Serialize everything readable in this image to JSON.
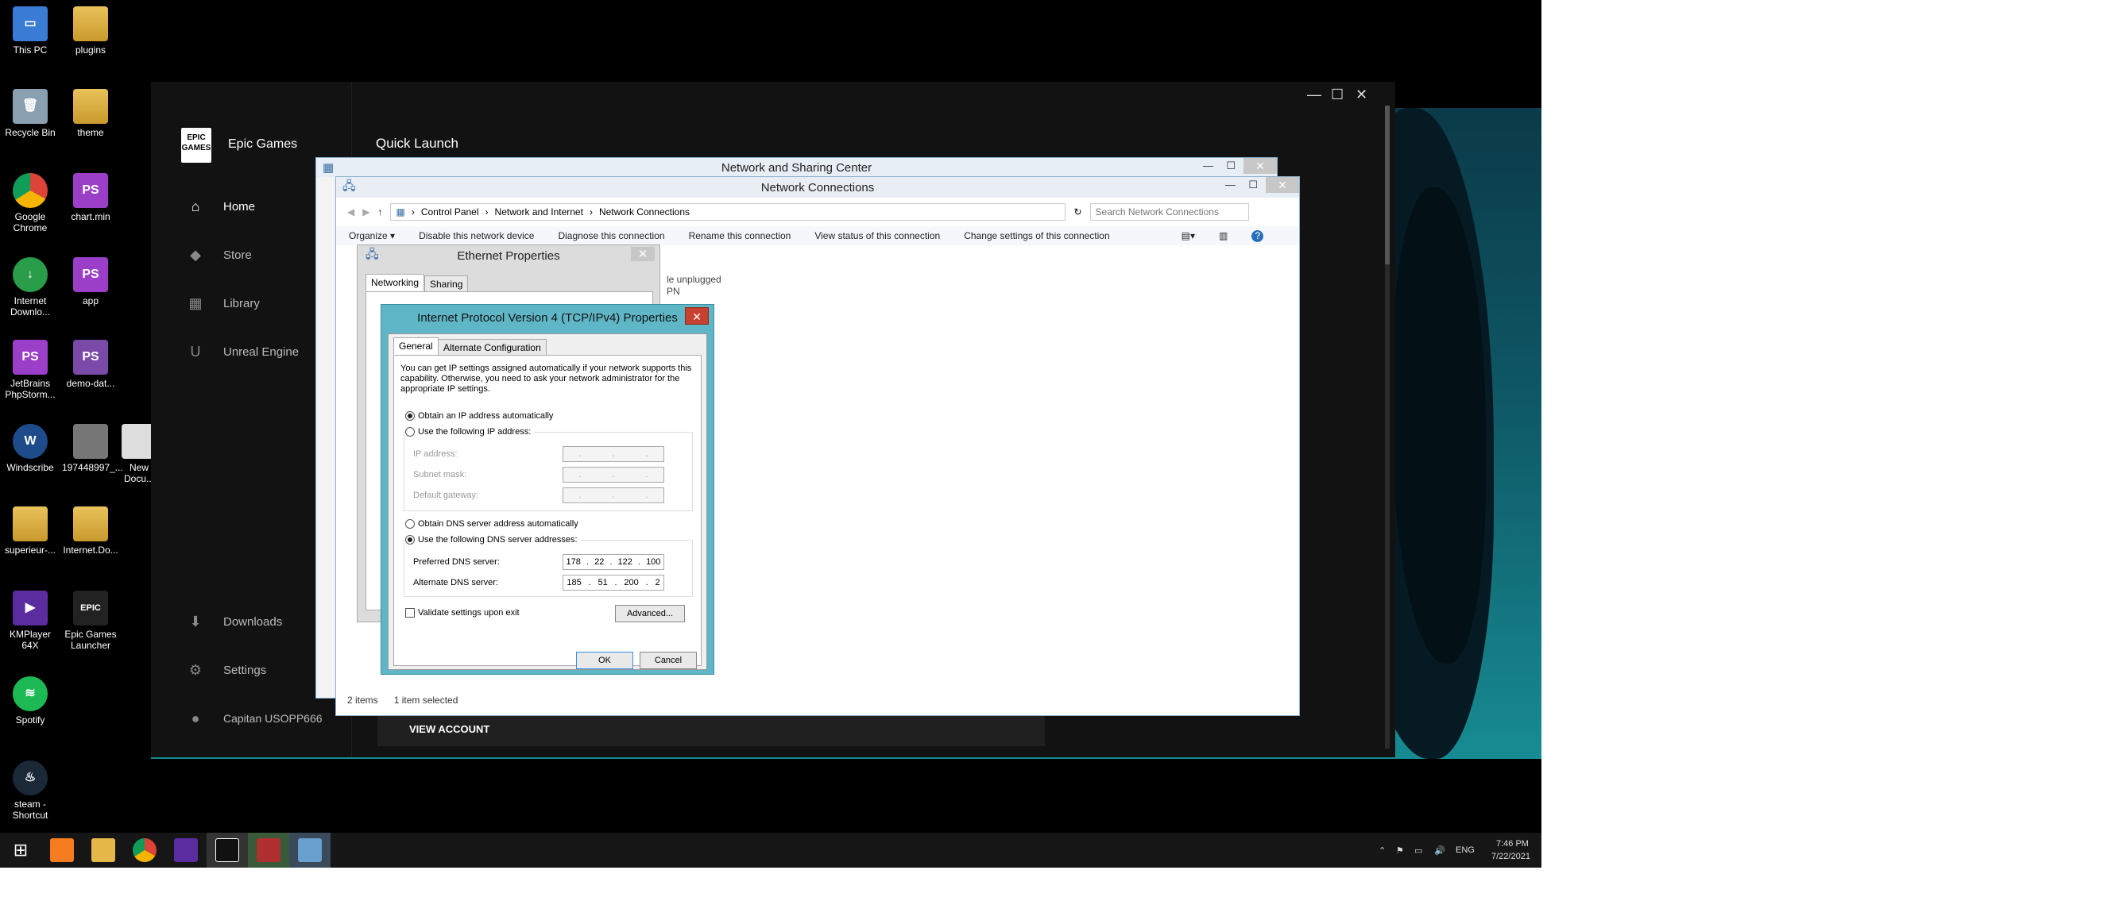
{
  "desktop": {
    "icons": [
      {
        "label": "This PC",
        "icon": "computer-icon"
      },
      {
        "label": "plugins",
        "icon": "folder-icon"
      },
      {
        "label": "Recycle Bin",
        "icon": "recycle-bin-icon"
      },
      {
        "label": "theme",
        "icon": "folder-icon"
      },
      {
        "label": "Google Chrome",
        "icon": "chrome-icon"
      },
      {
        "label": "chart.min",
        "icon": "phpstorm-icon"
      },
      {
        "label": "Internet Downlo...",
        "icon": "idm-icon"
      },
      {
        "label": "app",
        "icon": "phpstorm-icon"
      },
      {
        "label": "JetBrains PhpStorm...",
        "icon": "phpstorm-icon"
      },
      {
        "label": "demo-dat...",
        "icon": "file-icon"
      },
      {
        "label": "Windscribe",
        "icon": "windscribe-icon"
      },
      {
        "label": "197448997_...",
        "icon": "image-icon"
      },
      {
        "label": "New Docu...",
        "icon": "file-icon"
      },
      {
        "label": "superieur-...",
        "icon": "folder-icon"
      },
      {
        "label": "Internet.Do...",
        "icon": "folder-icon"
      },
      {
        "label": "KMPlayer 64X",
        "icon": "kmplayer-icon"
      },
      {
        "label": "Epic Games Launcher",
        "icon": "epic-icon"
      },
      {
        "label": "Spotify",
        "icon": "spotify-icon"
      },
      {
        "label": "steam - Shortcut",
        "icon": "steam-icon"
      }
    ]
  },
  "epic": {
    "brand": "Epic Games",
    "logo": "EPIC GAMES",
    "header": "Quick Launch",
    "nav": [
      {
        "label": "Home",
        "icon": "home-icon"
      },
      {
        "label": "Store",
        "icon": "tag-icon"
      },
      {
        "label": "Library",
        "icon": "grid-icon"
      },
      {
        "label": "Unreal Engine",
        "icon": "unreal-icon"
      }
    ],
    "downloads": "Downloads",
    "settings": "Settings",
    "account": "Capitan USOPP666",
    "view_account": "VIEW ACCOUNT",
    "win_controls": {
      "minimize": "—",
      "maximize": "☐",
      "close": "✕"
    }
  },
  "nsc": {
    "title": "Network and Sharing Center"
  },
  "netconn": {
    "title": "Network Connections",
    "breadcrumb": [
      "Control Panel",
      "Network and Internet",
      "Network Connections"
    ],
    "search_placeholder": "Search Network Connections",
    "toolbar": [
      "Organize ▾",
      "Disable this network device",
      "Diagnose this connection",
      "Rename this connection",
      "View status of this connection",
      "Change settings of this connection"
    ],
    "item_status_1": "le unplugged",
    "item_status_2": "PN",
    "status_items": "2 items",
    "status_selected": "1 item selected"
  },
  "ethernet": {
    "title": "Ethernet Properties",
    "tabs": [
      "Networking",
      "Sharing"
    ]
  },
  "tcp": {
    "title": "Internet Protocol Version 4 (TCP/IPv4) Properties",
    "tabs": [
      "General",
      "Alternate Configuration"
    ],
    "description": "You can get IP settings assigned automatically if your network supports this capability. Otherwise, you need to ask your network administrator for the appropriate IP settings.",
    "ip_auto": "Obtain an IP address automatically",
    "ip_manual": "Use the following IP address:",
    "ip_address_label": "IP address:",
    "subnet_label": "Subnet mask:",
    "gateway_label": "Default gateway:",
    "dns_auto": "Obtain DNS server address automatically",
    "dns_manual": "Use the following DNS server addresses:",
    "preferred_label": "Preferred DNS server:",
    "preferred": [
      "178",
      "22",
      "122",
      "100"
    ],
    "alternate_label": "Alternate DNS server:",
    "alternate": [
      "185",
      "51",
      "200",
      "2"
    ],
    "validate": "Validate settings upon exit",
    "advanced": "Advanced...",
    "ok": "OK",
    "cancel": "Cancel"
  },
  "taskbar": {
    "lang": "ENG",
    "time": "7:46 PM",
    "date": "7/22/2021"
  }
}
